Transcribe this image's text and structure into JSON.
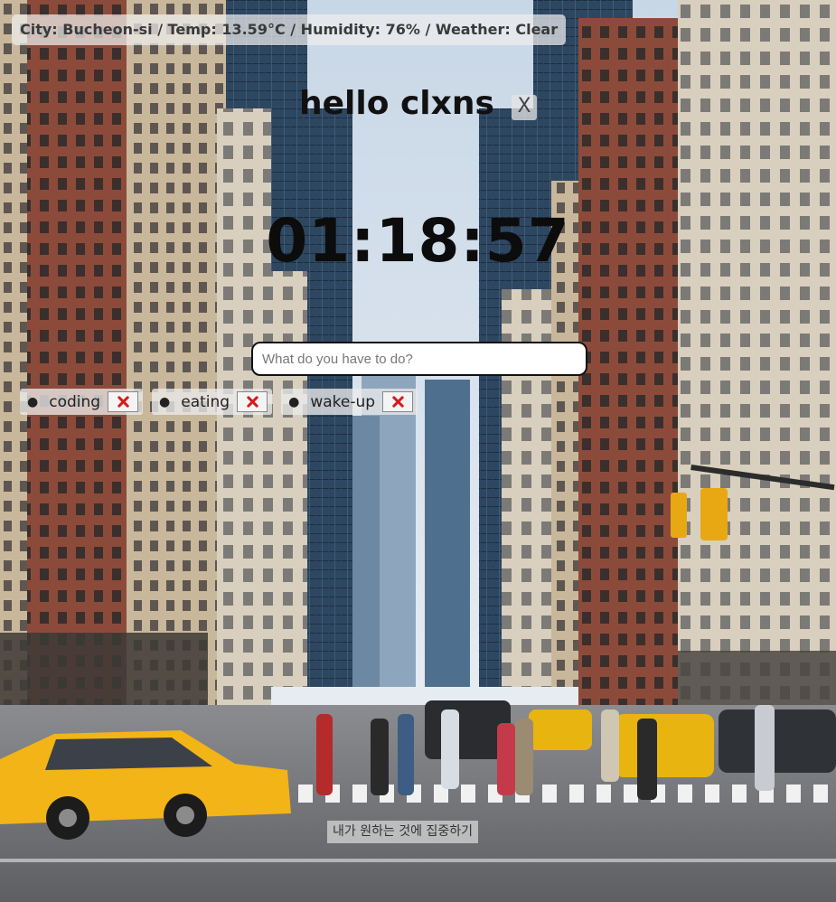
{
  "weather": {
    "text": "City: Bucheon-si / Temp: 13.59°C / Humidity: 76% / Weather: Clear"
  },
  "greeting": {
    "text": "hello clxns",
    "close_label": "X"
  },
  "clock": {
    "time": "01:18:57"
  },
  "todo_form": {
    "placeholder": "What do you have to do?",
    "value": ""
  },
  "todos": [
    {
      "text": "coding",
      "delete_icon": "red-cross-mark-icon"
    },
    {
      "text": "eating",
      "delete_icon": "red-cross-mark-icon"
    },
    {
      "text": "wake-up",
      "delete_icon": "red-cross-mark-icon"
    }
  ],
  "quote": {
    "text": "내가 원하는 것에 집중하기"
  },
  "background": {
    "scene": "city-street-photo",
    "colors": {
      "sky": "#dfe8f0",
      "taxi": "#f2b416",
      "road": "#6e7073",
      "building_dark": "#2d3f52",
      "building_brick": "#8a4a38",
      "building_light": "#d7cdbb"
    }
  }
}
